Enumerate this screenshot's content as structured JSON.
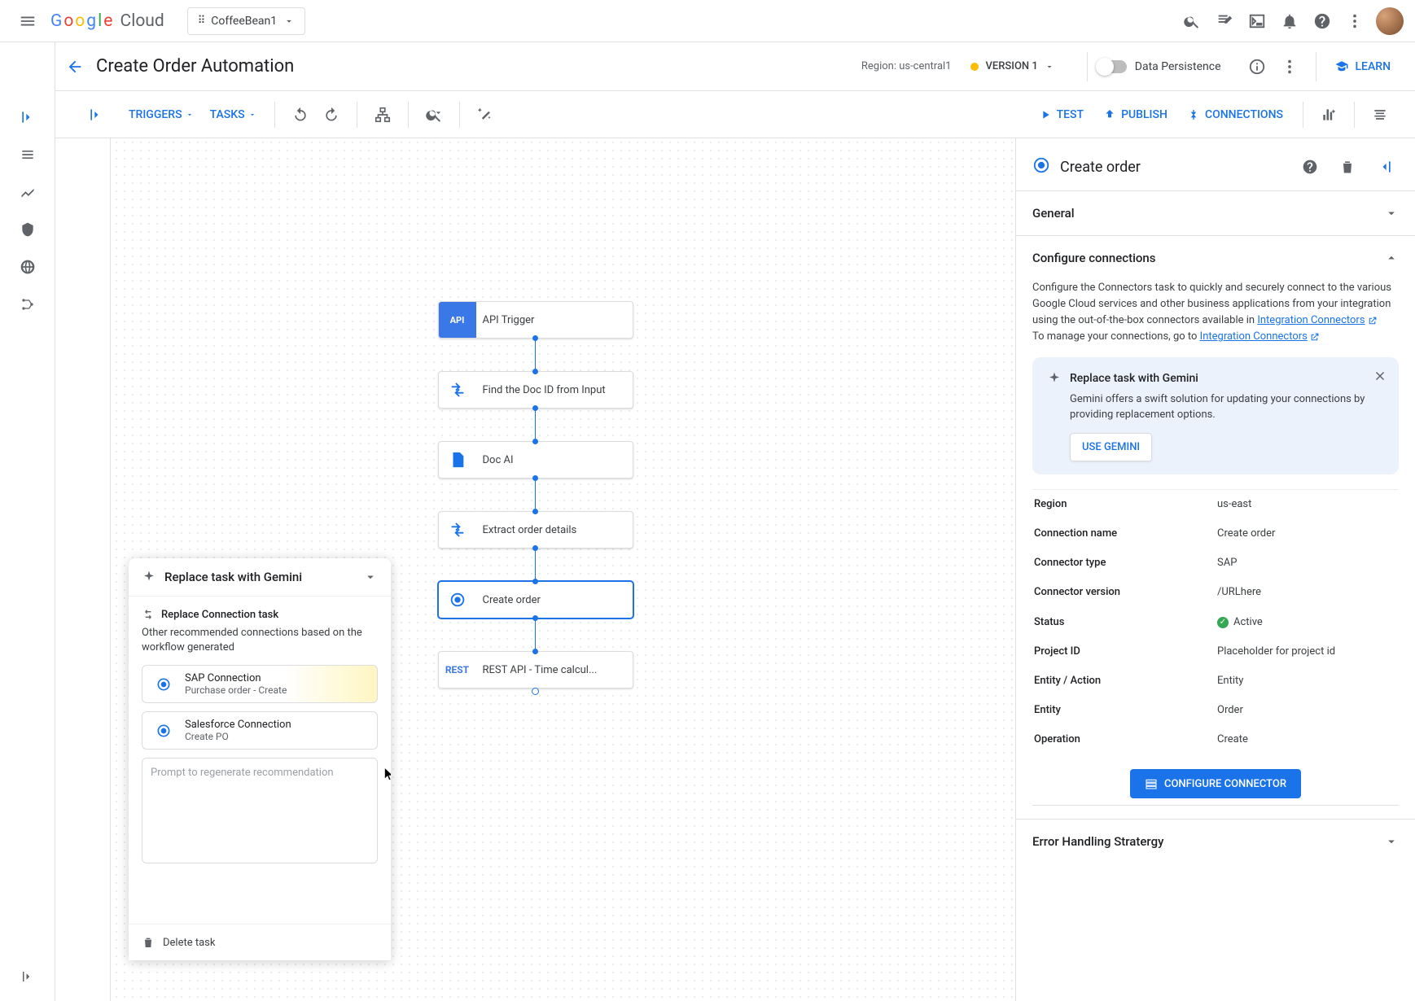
{
  "top": {
    "brand": "Google Cloud",
    "project": "CoffeeBean1"
  },
  "subheader": {
    "title": "Create Order Automation",
    "region": "Region: us-central1",
    "version": "VERSION 1",
    "persistence": "Data Persistence",
    "learn": "LEARN"
  },
  "toolbar": {
    "triggers": "TRIGGERS",
    "tasks": "TASKS",
    "test": "TEST",
    "publish": "PUBLISH",
    "connections": "CONNECTIONS"
  },
  "flow": {
    "n1": "API Trigger",
    "n2": "Find the Doc ID from Input",
    "n3": "Doc AI",
    "n4": "Extract order details",
    "n5": "Create order",
    "n6": "REST API - Time calcul..."
  },
  "gemini": {
    "title": "Replace task with Gemini",
    "sub": "Replace Connection task",
    "desc": "Other recommended connections based on the workflow generated",
    "c1t": "SAP Connection",
    "c1s": "Purchase order - Create",
    "c2t": "Salesforce Connection",
    "c2s": "Create PO",
    "placeholder": "Prompt to regenerate recommendation",
    "delete": "Delete task"
  },
  "panel": {
    "title": "Create order",
    "sections": {
      "general": "General",
      "configure": "Configure connections",
      "error": "Error Handling Stratergy"
    },
    "desc1": "Configure the Connectors task to quickly and securely connect to the various Google Cloud services and other business applications from your integration using the out-of-the-box connectors available in ",
    "desc1_link": "Integration Connectors",
    "desc2a": "To manage your connections, go to ",
    "desc2_link": "Integration Connectors",
    "card": {
      "title": "Replace task with Gemini",
      "desc": "Gemini offers a swift solution for updating your connections by providing replacement options.",
      "button": "USE GEMINI"
    },
    "kv": {
      "region_k": "Region",
      "region_v": "us-east",
      "conn_k": "Connection name",
      "conn_v": "Create order",
      "type_k": "Connector type",
      "type_v": "SAP",
      "ver_k": "Connector version",
      "ver_v": "/URLhere",
      "status_k": "Status",
      "status_v": "Active",
      "proj_k": "Project ID",
      "proj_v": "Placeholder for project id",
      "ea_k": "Entity / Action",
      "ea_v": "Entity",
      "ent_k": "Entity",
      "ent_v": "Order",
      "op_k": "Operation",
      "op_v": "Create"
    },
    "config_btn": "CONFIGURE CONNECTOR"
  }
}
